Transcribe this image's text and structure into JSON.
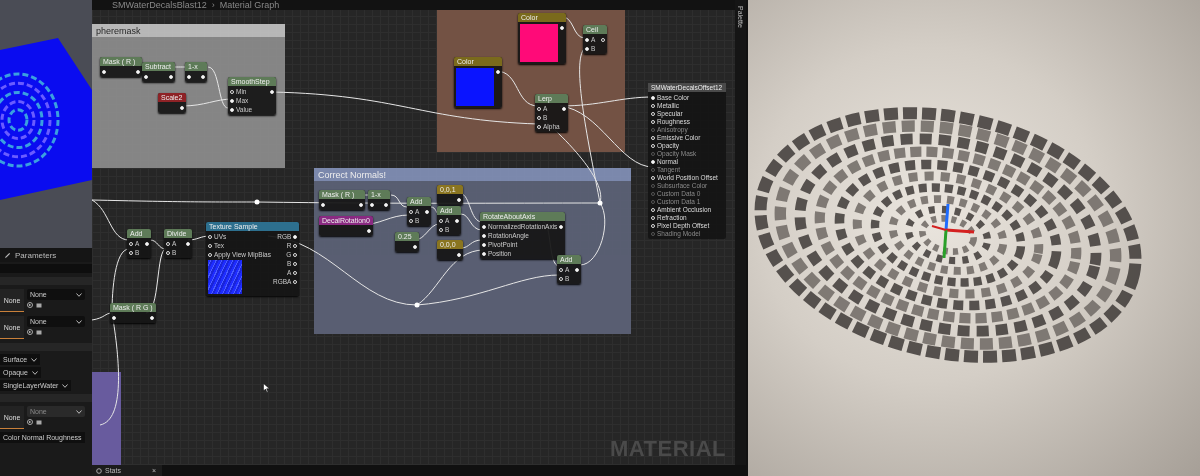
{
  "breadcrumb": {
    "asset": "SMWaterDecalsBlast12",
    "separator": "›",
    "graph": "Material Graph"
  },
  "palette_tab": {
    "label": "Palette"
  },
  "comments": [
    {
      "title": "pheremask",
      "color": "#8e8e8e"
    },
    {
      "color": "#7a5646"
    },
    {
      "title": "Correct Normals!",
      "color": "#5d6378"
    },
    {
      "color": "#6e5fa8"
    }
  ],
  "nodes": [
    {
      "title": "Mask ( R )",
      "kind": "math",
      "inputs": [
        {
          "connected": true
        }
      ],
      "outputs": [
        {
          "connected": true
        }
      ]
    },
    {
      "title": "Subtract",
      "kind": "math",
      "inputs": [
        {
          "connected": true
        }
      ],
      "outputs": [
        {
          "connected": true
        }
      ]
    },
    {
      "title": "1-x",
      "kind": "math",
      "inputs": [
        {
          "connected": true
        }
      ],
      "outputs": [
        {
          "connected": true
        }
      ]
    },
    {
      "title": "Scale2",
      "kind": "scalar",
      "outputs": [
        {
          "connected": true
        }
      ]
    },
    {
      "title": "SmoothStep",
      "kind": "math",
      "inputs": [
        {
          "label": "Min",
          "connected": false
        },
        {
          "label": "Max",
          "connected": true
        },
        {
          "label": "Value",
          "connected": true
        }
      ],
      "outputs": [
        {
          "connected": true
        }
      ]
    },
    {
      "title": "Color",
      "kind": "color",
      "color": "#ff0a78",
      "outputs": [
        {
          "connected": true
        }
      ]
    },
    {
      "title": "Ceil",
      "kind": "math",
      "inputs": [
        {
          "label": "A",
          "connected": true
        },
        {
          "label": "B",
          "connected": true
        }
      ],
      "outputs": [
        {
          "connected": false
        }
      ]
    },
    {
      "title": "Color",
      "kind": "color",
      "color": "#0a14ff",
      "outputs": [
        {
          "connected": true
        }
      ]
    },
    {
      "title": "Lerp",
      "kind": "math",
      "inputs": [
        {
          "label": "A",
          "connected": false
        },
        {
          "label": "B",
          "connected": false
        },
        {
          "label": "Alpha",
          "connected": false
        }
      ],
      "outputs": [
        {
          "connected": true
        }
      ]
    },
    {
      "title": "Mask ( R )",
      "kind": "math",
      "inputs": [
        {
          "connected": true
        }
      ],
      "outputs": [
        {
          "connected": true
        }
      ]
    },
    {
      "title": "1-x",
      "kind": "math",
      "inputs": [
        {
          "connected": true
        }
      ],
      "outputs": [
        {
          "connected": true
        }
      ]
    },
    {
      "title": "DecalRotation0",
      "kind": "collection",
      "outputs": [
        {
          "connected": true
        }
      ]
    },
    {
      "title": "Add",
      "kind": "math",
      "inputs": [
        {
          "label": "A",
          "connected": false
        },
        {
          "label": "B",
          "connected": false
        }
      ],
      "outputs": [
        {
          "connected": true
        }
      ]
    },
    {
      "title": "0.25",
      "kind": "math",
      "outputs": [
        {
          "connected": true
        }
      ]
    },
    {
      "title": "0,0,1",
      "kind": "vector",
      "outputs": [
        {
          "connected": true
        }
      ]
    },
    {
      "title": "Add",
      "kind": "math",
      "inputs": [
        {
          "label": "A",
          "connected": false
        },
        {
          "label": "B",
          "connected": false
        }
      ],
      "outputs": [
        {
          "connected": true
        }
      ]
    },
    {
      "title": "0,0,0",
      "kind": "vector",
      "outputs": [
        {
          "connected": true
        }
      ]
    },
    {
      "title": "RotateAboutAxis",
      "kind": "math",
      "inputs": [
        {
          "label": "NormalizedRotationAxis",
          "connected": true
        },
        {
          "label": "RotationAngle",
          "connected": true
        },
        {
          "label": "PivotPoint",
          "connected": true
        },
        {
          "label": "Position",
          "connected": true
        }
      ],
      "outputs": [
        {
          "connected": true
        }
      ]
    },
    {
      "title": "Add",
      "kind": "math",
      "inputs": [
        {
          "label": "A",
          "connected": false
        },
        {
          "label": "B",
          "connected": false
        }
      ],
      "outputs": [
        {
          "connected": true
        }
      ]
    },
    {
      "title": "Add",
      "kind": "math",
      "inputs": [
        {
          "label": "A",
          "connected": false
        },
        {
          "label": "B",
          "connected": false
        }
      ],
      "outputs": [
        {
          "connected": true
        }
      ]
    },
    {
      "title": "Divide",
      "kind": "math",
      "inputs": [
        {
          "label": "A",
          "connected": false
        },
        {
          "label": "B",
          "connected": false
        }
      ],
      "outputs": [
        {
          "connected": true
        }
      ]
    },
    {
      "title": "Texture Sample",
      "kind": "texture",
      "inputs": [
        {
          "label": "UVs",
          "connected": false
        },
        {
          "label": "Tex",
          "connected": false
        },
        {
          "label": "Apply View MipBias",
          "connected": false
        }
      ],
      "outputs": [
        {
          "label": "RGB",
          "connected": true
        },
        {
          "label": "R",
          "connected": false
        },
        {
          "label": "G",
          "connected": false
        },
        {
          "label": "B",
          "connected": false
        },
        {
          "label": "A",
          "connected": false
        },
        {
          "label": "RGBA",
          "connected": false
        }
      ]
    },
    {
      "title": "Mask ( R G )",
      "kind": "math",
      "inputs": [
        {
          "connected": true
        }
      ],
      "outputs": [
        {
          "connected": true
        }
      ]
    }
  ],
  "material_output": {
    "title": "SMWaterDecalsOffset12",
    "pins": [
      {
        "label": "Base Color",
        "connected": true,
        "disabled": false
      },
      {
        "label": "Metallic",
        "connected": false,
        "disabled": false
      },
      {
        "label": "Specular",
        "connected": false,
        "disabled": false
      },
      {
        "label": "Roughness",
        "connected": false,
        "disabled": false
      },
      {
        "label": "Anisotropy",
        "connected": false,
        "disabled": true
      },
      {
        "label": "Emissive Color",
        "connected": false,
        "disabled": false
      },
      {
        "label": "Opacity",
        "connected": false,
        "disabled": false
      },
      {
        "label": "Opacity Mask",
        "connected": false,
        "disabled": true
      },
      {
        "label": "Normal",
        "connected": true,
        "disabled": false
      },
      {
        "label": "Tangent",
        "connected": false,
        "disabled": true
      },
      {
        "label": "World Position Offset",
        "connected": false,
        "disabled": false
      },
      {
        "label": "Subsurface Color",
        "connected": false,
        "disabled": true
      },
      {
        "label": "Custom Data 0",
        "connected": false,
        "disabled": true
      },
      {
        "label": "Custom Data 1",
        "connected": false,
        "disabled": true
      },
      {
        "label": "Ambient Occlusion",
        "connected": false,
        "disabled": false
      },
      {
        "label": "Refraction",
        "connected": false,
        "disabled": false
      },
      {
        "label": "Pixel Depth Offset",
        "connected": false,
        "disabled": false
      },
      {
        "label": "Shading Model",
        "connected": false,
        "disabled": true
      }
    ]
  },
  "graph_label": "MATERIAL",
  "parameters_panel": {
    "tab": "Parameters",
    "texture_rows": [
      {
        "thumb": "None",
        "value": "None",
        "disabled": false
      },
      {
        "thumb": "None",
        "value": "None",
        "disabled": false
      }
    ],
    "dropdowns": [
      {
        "value": "Surface"
      },
      {
        "value": "Opaque"
      },
      {
        "value": "SingleLayerWater"
      }
    ],
    "texture_rows_2": [
      {
        "thumb": "None",
        "value": "None",
        "disabled": true
      }
    ],
    "bottom_dropdown": "Color Normal Roughness"
  },
  "bottom_tabs": [
    {
      "label": "Stats",
      "close": "×"
    }
  ]
}
